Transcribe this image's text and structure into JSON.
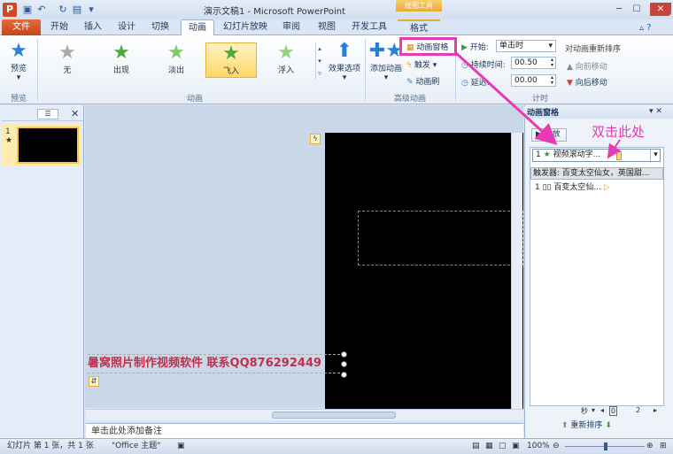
{
  "window": {
    "title": "演示文稿1 - Microsoft PowerPoint",
    "contextual_tab_group": "绘图工具"
  },
  "tabs": [
    "文件",
    "开始",
    "插入",
    "设计",
    "切换",
    "动画",
    "幻灯片放映",
    "审阅",
    "视图",
    "开发工具",
    "格式"
  ],
  "ribbon": {
    "preview": {
      "label": "预览",
      "group": "预览"
    },
    "effects": [
      "无",
      "出现",
      "淡出",
      "飞入",
      "浮入"
    ],
    "effect_options": "效果选项",
    "animation_group": "动画",
    "add_animation": "添加动画",
    "animation_pane": "动画窗格",
    "trigger": "触发",
    "animation_painter": "动画刷",
    "advanced_group": "高级动画",
    "start_label": "开始:",
    "start_value": "单击时",
    "duration_label": "持续时间:",
    "duration_value": "00.50",
    "delay_label": "延迟:",
    "delay_value": "00.00",
    "timing_group": "计时",
    "reorder_title": "对动画重新排序",
    "move_earlier": "向前移动",
    "move_later": "向后移动"
  },
  "slide_panel": {
    "slide_number": "1",
    "star": "★"
  },
  "slide": {
    "banner": "暑窝照片制作视频软件 联系QQ876292449"
  },
  "notes_placeholder": "单击此处添加备注",
  "animation_pane": {
    "title": "动画窗格",
    "play": "播放",
    "item1_index": "1",
    "item1_label": "视频滚动字...",
    "trigger_text": "触发器: 百变太空仙女，英国甜...",
    "item2_index": "1",
    "item2_label": "百变太空仙...",
    "seconds": "秒",
    "ruler_0": "0",
    "ruler_2": "2",
    "reorder": "重新排序"
  },
  "annotation": {
    "double_click": "双击此处"
  },
  "status": {
    "slide_info": "幻灯片 第 1 张，共 1 张",
    "theme": "\"Office 主题\"",
    "zoom": "100%"
  },
  "colors": {
    "highlight": "#e83ab3",
    "file_tab": "#d24726"
  }
}
